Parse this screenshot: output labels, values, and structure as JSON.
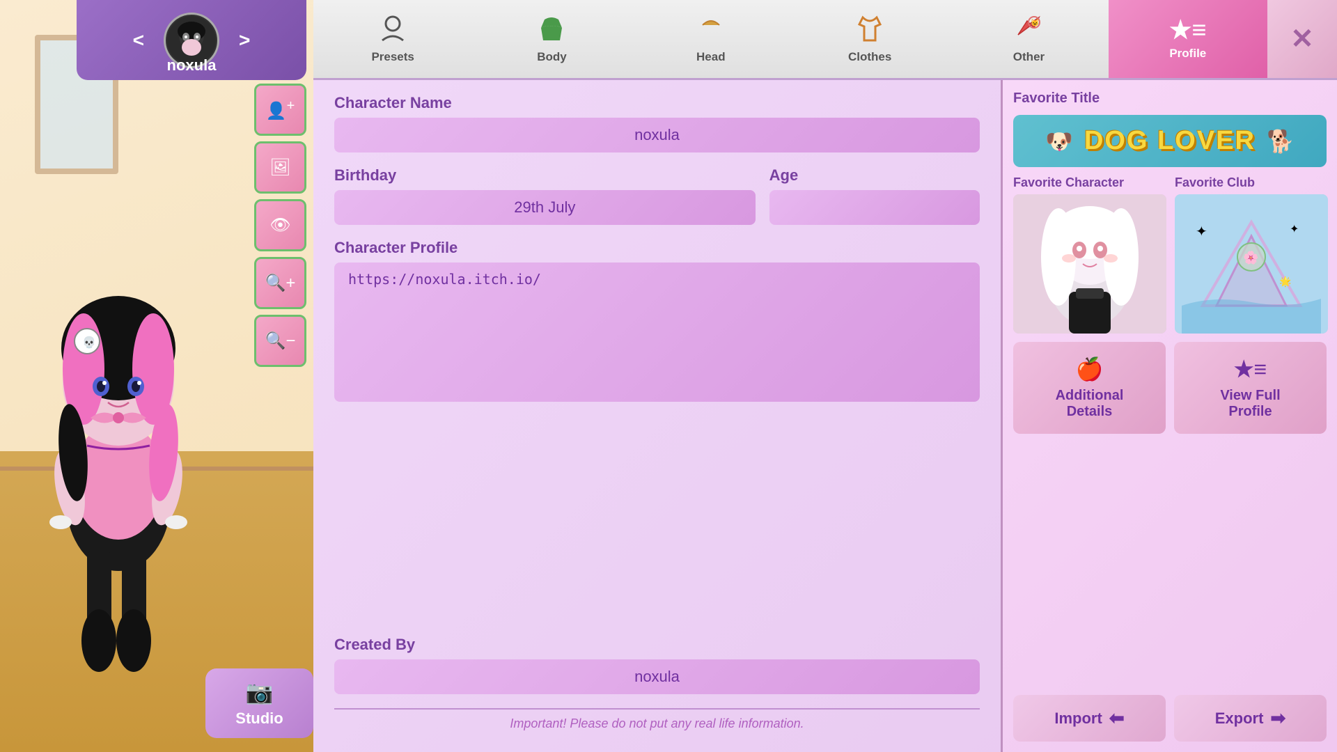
{
  "character": {
    "name": "noxula",
    "avatar_label": "character-avatar"
  },
  "tabs": [
    {
      "id": "presets",
      "label": "Presets",
      "icon": "👤",
      "active": false
    },
    {
      "id": "body",
      "label": "Body",
      "icon": "👕",
      "active": false
    },
    {
      "id": "head",
      "label": "Head",
      "icon": "🎩",
      "active": false
    },
    {
      "id": "clothes",
      "label": "Clothes",
      "icon": "👔",
      "active": false
    },
    {
      "id": "other",
      "label": "Other",
      "icon": "⚔️",
      "active": false
    },
    {
      "id": "profile",
      "label": "Profile",
      "icon": "★≡",
      "active": true
    }
  ],
  "close_btn": "✕",
  "profile": {
    "char_name_label": "Character Name",
    "char_name_value": "noxula",
    "birthday_label": "Birthday",
    "birthday_value": "29th July",
    "age_label": "Age",
    "age_value": "",
    "char_profile_label": "Character Profile",
    "char_profile_value": "https://noxula.itch.io/",
    "created_by_label": "Created By",
    "created_by_value": "noxula",
    "disclaimer": "Important! Please do not put any real life information."
  },
  "right_panel": {
    "fav_title_label": "Favorite Title",
    "dog_lover_text": "DOG LOVER",
    "fav_char_label": "Favorite Character",
    "fav_club_label": "Favorite Club",
    "add_details_label": "Additional\nDetails",
    "view_profile_label": "View Full\nProfile",
    "import_label": "Import",
    "export_label": "Export"
  },
  "side_tools": {
    "tool1_icon": "👤+",
    "tool2_icon": "🖼",
    "tool3_icon": "👁",
    "tool4_icon": "🔍+",
    "tool5_icon": "🔍-"
  },
  "studio": {
    "icon": "📷",
    "label": "Studio"
  },
  "nav": {
    "prev": "<",
    "next": ">"
  }
}
